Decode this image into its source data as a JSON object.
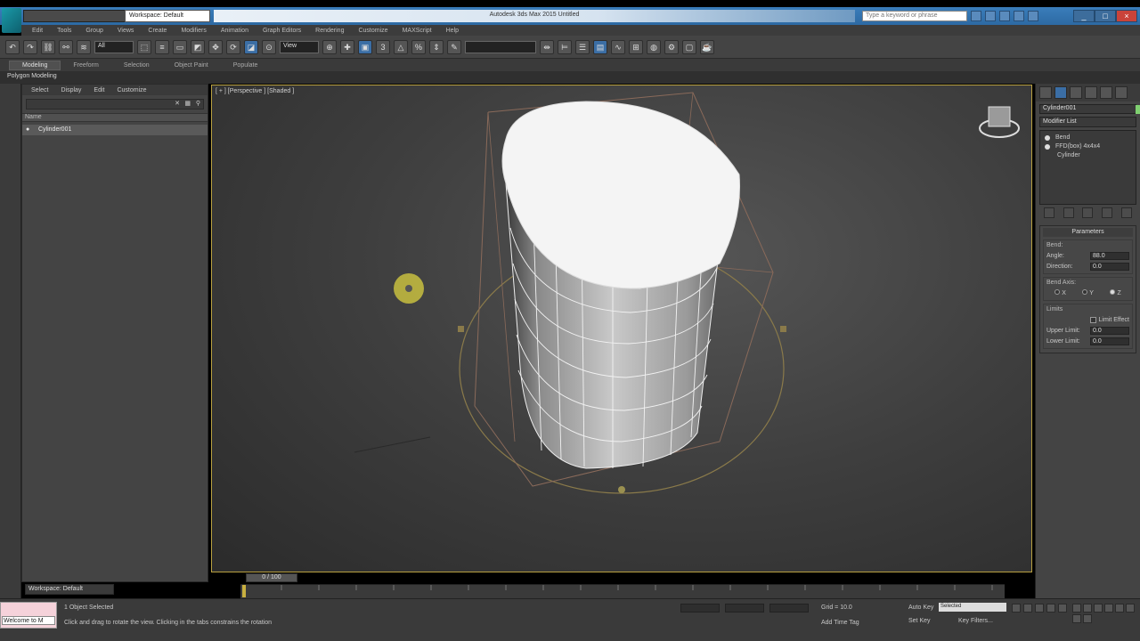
{
  "titlebar": {
    "workspace": "Workspace: Default",
    "document_title": "Autodesk 3ds Max 2015   Untitled",
    "search_placeholder": "Type a keyword or phrase"
  },
  "menubar": [
    "Edit",
    "Tools",
    "Group",
    "Views",
    "Create",
    "Modifiers",
    "Animation",
    "Graph Editors",
    "Rendering",
    "Customize",
    "MAXScript",
    "Help"
  ],
  "toolbar": {
    "selection_filter": "All",
    "reference_coord": "View"
  },
  "ribbon": {
    "tabs": [
      "Modeling",
      "Freeform",
      "Selection",
      "Object Paint",
      "Populate"
    ],
    "active_tab": "Modeling",
    "panel_label": "Polygon Modeling"
  },
  "scene_explorer": {
    "menu": [
      "Select",
      "Display",
      "Edit",
      "Customize"
    ],
    "column_header": "Name",
    "objects": [
      "Cylinder001"
    ]
  },
  "viewport": {
    "label": "[ + ] [Perspective ] [Shaded ]"
  },
  "command_panel": {
    "object_name": "Cylinder001",
    "modifier_list": "Modifier List",
    "stack": [
      {
        "name": "Bend",
        "level": 0
      },
      {
        "name": "FFD(box) 4x4x4",
        "level": 0
      },
      {
        "name": "Cylinder",
        "level": 1
      }
    ],
    "parameters": {
      "title": "Parameters",
      "bend_group": "Bend:",
      "angle_label": "Angle:",
      "angle_value": "88.0",
      "direction_label": "Direction:",
      "direction_value": "0.0",
      "bend_axis_group": "Bend Axis:",
      "axes": [
        "X",
        "Y",
        "Z"
      ],
      "selected_axis": "Z",
      "limits_group": "Limits",
      "limit_effect_label": "Limit Effect",
      "upper_limit_label": "Upper Limit:",
      "upper_limit_value": "0.0",
      "lower_limit_label": "Lower Limit:",
      "lower_limit_value": "0.0"
    }
  },
  "timeline": {
    "slider_text": "0 / 100",
    "workspace": "Workspace: Default"
  },
  "statusbar": {
    "maxscript_text": "Welcome to M",
    "status": "1 Object Selected",
    "prompt": "Click and drag to rotate the view.  Clicking in the tabs constrains the rotation",
    "grid": "Grid = 10.0",
    "add_time_tag": "Add Time Tag",
    "auto_key": "Auto Key",
    "selected": "Selected",
    "set_key": "Set Key",
    "key_filters": "Key Filters..."
  },
  "colors": {
    "viewport_border": "#b8a040",
    "object_color": "#7fd070",
    "titlebar": "#3a7dbb"
  }
}
